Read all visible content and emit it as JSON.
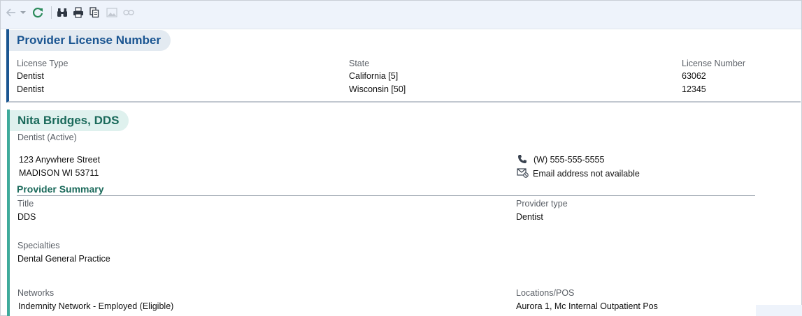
{
  "license_card": {
    "title": "Provider License Number",
    "columns": [
      "License Type",
      "State",
      "License Number"
    ],
    "rows": [
      [
        "Dentist",
        "California [5]",
        "63062"
      ],
      [
        "Dentist",
        "Wisconsin [50]",
        "12345"
      ]
    ]
  },
  "provider_card": {
    "name": "Nita Bridges, DDS",
    "status": "Dentist (Active)",
    "address_line1": "123 Anywhere Street",
    "address_line2": "MADISON WI 53711",
    "phone": "(W) 555-555-5555",
    "email": "Email address not available",
    "summary_title": "Provider Summary",
    "title_label": "Title",
    "title_value": "DDS",
    "provider_type_label": "Provider type",
    "provider_type_value": "Dentist",
    "specialties_label": "Specialties",
    "specialties_value": "Dental General Practice",
    "networks_label": "Networks",
    "networks_value": "Indemnity Network - Employed (Eligible)",
    "locations_label": "Locations/POS",
    "locations_value": "Aurora 1, Mc Internal Outpatient Pos"
  },
  "colors": {
    "license_accent": "#1a5591",
    "provider_accent": "#3eaa9b",
    "toolbar_bg": "#eef3fb"
  },
  "toolbar_icons": [
    "back-icon",
    "dropdown-arrow-icon",
    "refresh-icon",
    "binoculars-icon",
    "print-icon",
    "copy-icon",
    "image-icon",
    "link-icon"
  ]
}
